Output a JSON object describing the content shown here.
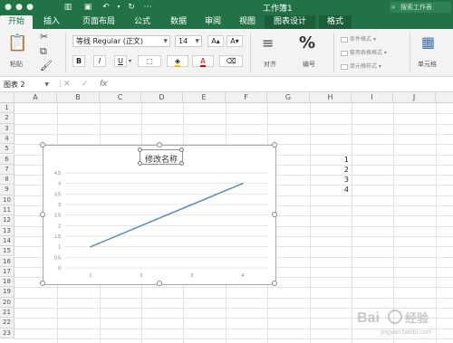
{
  "window": {
    "title": "工作簿1",
    "search_placeholder": "搜索工作表"
  },
  "tabs": [
    {
      "label": "开始",
      "active": true
    },
    {
      "label": "插入"
    },
    {
      "label": "页面布局"
    },
    {
      "label": "公式"
    },
    {
      "label": "数据"
    },
    {
      "label": "审阅"
    },
    {
      "label": "视图"
    },
    {
      "label": "图表设计",
      "context": true
    },
    {
      "label": "格式"
    }
  ],
  "ribbon": {
    "paste_label": "粘贴",
    "font_name": "等线 Regular (正文)",
    "font_size": "14",
    "grow_font": "A▴",
    "shrink_font": "A▾",
    "bold": "B",
    "italic": "I",
    "underline": "U",
    "align_label": "对齐",
    "number_label": "编号",
    "percent_symbol": "%",
    "conditional_format": "条件格式",
    "format_as_table": "套用表格格式",
    "cell_styles": "单元格样式",
    "cells_label": "单元格"
  },
  "formula_bar": {
    "name_box": "图表 2",
    "cancel": "✕",
    "enter": "✓",
    "fx": "fx",
    "value": ""
  },
  "columns": [
    "A",
    "B",
    "C",
    "D",
    "E",
    "F",
    "G",
    "H",
    "I",
    "J"
  ],
  "rows": [
    "1",
    "2",
    "3",
    "4",
    "5",
    "6",
    "7",
    "8",
    "9",
    "10",
    "11",
    "12",
    "13",
    "14",
    "15",
    "16",
    "17",
    "18",
    "19",
    "20",
    "21",
    "22",
    "23"
  ],
  "cells": [
    {
      "ref": "H6",
      "value": "1"
    },
    {
      "ref": "H7",
      "value": "2"
    },
    {
      "ref": "H8",
      "value": "3"
    },
    {
      "ref": "H9",
      "value": "4"
    }
  ],
  "chart_data": {
    "type": "line",
    "title": "修改名称",
    "categories": [
      "1",
      "2",
      "3",
      "4"
    ],
    "series": [
      {
        "values": [
          1,
          2,
          3,
          4
        ],
        "color": "#5b8fb0"
      }
    ],
    "ylim": [
      0,
      4.5
    ],
    "yticks": [
      "0",
      "0.5",
      "1",
      "1.5",
      "2",
      "2.5",
      "3",
      "3.5",
      "4",
      "4.5"
    ],
    "grid": true,
    "legend": "none"
  },
  "colors": {
    "accent": "#217346",
    "series": "#5b8fb0"
  },
  "watermark": {
    "text": "Bai 经验",
    "url_text": "jingyan.baidu.com"
  }
}
